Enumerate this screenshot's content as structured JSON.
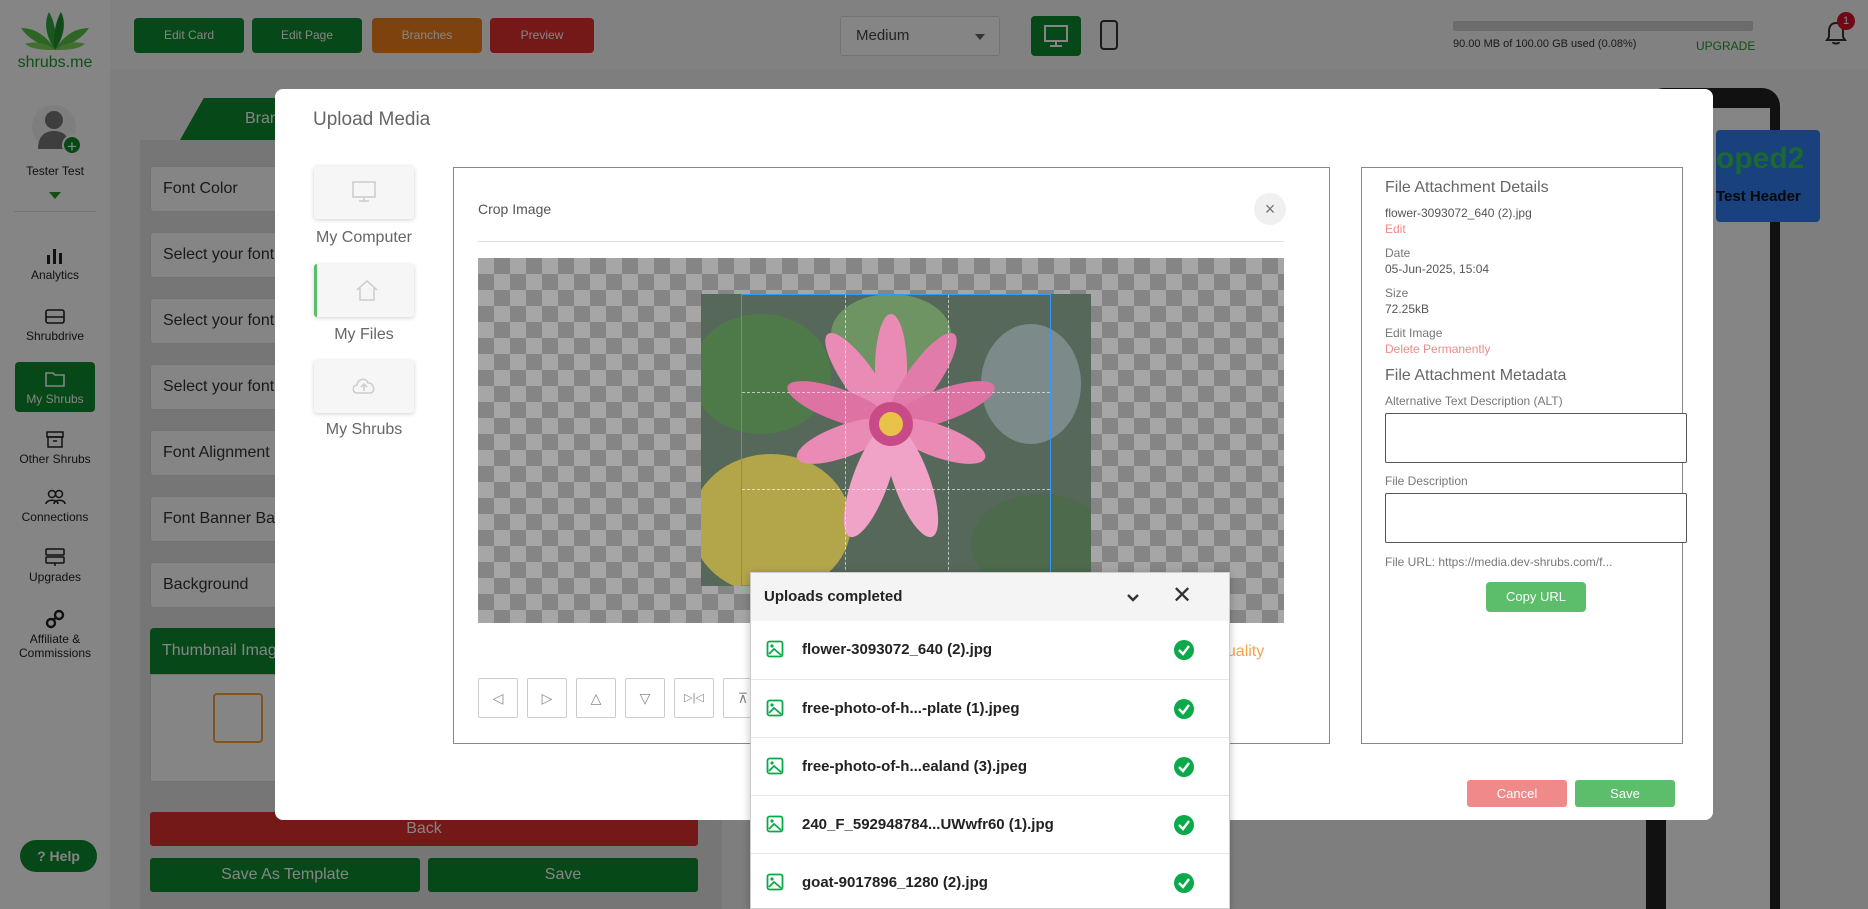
{
  "logo": {
    "text": "shrubs.me"
  },
  "user": {
    "name": "Tester Test"
  },
  "sidebar": {
    "items": [
      {
        "label": "Analytics",
        "icon": "bar-chart-icon"
      },
      {
        "label": "Shrubdrive",
        "icon": "drive-icon"
      },
      {
        "label": "My Shrubs",
        "icon": "folder-icon"
      },
      {
        "label": "Other Shrubs",
        "icon": "archive-icon"
      },
      {
        "label": "Connections",
        "icon": "people-icon"
      },
      {
        "label": "Upgrades",
        "icon": "server-icon"
      },
      {
        "label": "Affiliate & Commissions",
        "icon": "link-icon"
      }
    ],
    "help_label": "Help"
  },
  "topbar": {
    "edit_card": "Edit Card",
    "edit_page": "Edit Page",
    "branches": "Branches",
    "preview": "Preview",
    "size_select": "Medium",
    "storage_text": "90.00 MB of 100.00 GB used (0.08%)",
    "storage_fraction": 0.0008,
    "upgrade": "UPGRADE",
    "notification_count": "1"
  },
  "editor": {
    "tab_label": "Branc",
    "fields": [
      "Font Color",
      "Select your font",
      "Select your font",
      "Select your font",
      "Font Alignment",
      "Font Banner Ba",
      "Background"
    ],
    "thumbnail_label": "Thumbnail Imag",
    "back": "Back",
    "save_template": "Save As Template",
    "save": "Save"
  },
  "preview": {
    "title": "oped2",
    "subtitle": "Test Header"
  },
  "modal": {
    "title": "Upload Media",
    "sources": [
      {
        "label": "My Computer",
        "icon": "monitor-icon"
      },
      {
        "label": "My Files",
        "icon": "home-icon"
      },
      {
        "label": "My Shrubs",
        "icon": "cloud-upload-icon"
      }
    ],
    "crop": {
      "title": "Crop Image",
      "close": "×",
      "quality_text": "quality",
      "tools": [
        "◁",
        "▷",
        "△",
        "▽",
        "▷|◁",
        "⊼"
      ]
    },
    "details": {
      "heading": "File Attachment Details",
      "file_name": "flower-3093072_640 (2).jpg",
      "edit": "Edit",
      "date_label": "Date",
      "date_value": "05-Jun-2025, 15:04",
      "size_label": "Size",
      "size_value": "72.25kB",
      "edit_image": "Edit Image",
      "delete": "Delete Permanently",
      "metadata_heading": "File Attachment Metadata",
      "alt_label": "Alternative Text Description (ALT)",
      "desc_label": "File Description",
      "file_url": "File URL: https://media.dev-shrubs.com/f...",
      "copy_url": "Copy URL"
    },
    "cancel": "Cancel",
    "save": "Save"
  },
  "uploads": {
    "title": "Uploads completed",
    "files": [
      "flower-3093072_640 (2).jpg",
      "free-photo-of-h...-plate (1).jpeg",
      "free-photo-of-h...ealand (3).jpeg",
      "240_F_592948784...UWwfr60 (1).jpg",
      "goat-9017896_1280 (2).jpg"
    ]
  }
}
